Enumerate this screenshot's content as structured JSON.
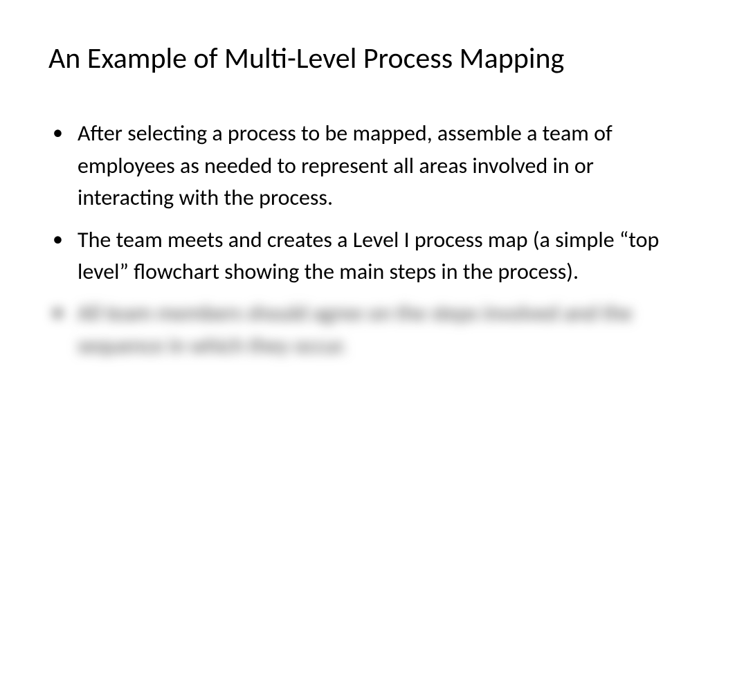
{
  "slide": {
    "title": "An Example of Multi-Level Process Mapping",
    "bullets": [
      "After selecting a process to be mapped, assemble a team of employees as needed to represent all areas involved in or interacting with the process.",
      "The team meets and creates a Level I process map (a simple “top level” flowchart showing the main steps in the process).",
      "All team members should agree on the steps involved and the sequence in which they occur."
    ]
  }
}
